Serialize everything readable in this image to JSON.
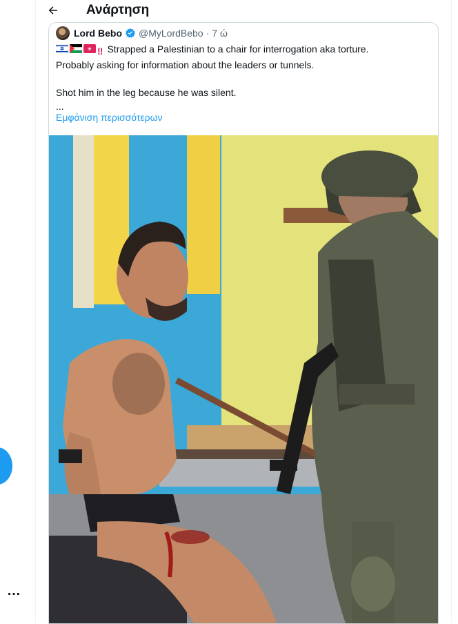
{
  "header": {
    "title": "Ανάρτηση"
  },
  "left_rail": {
    "more_label": "…"
  },
  "tweet": {
    "author_name": "Lord Bebo",
    "handle": "@MyLordBebo",
    "separator": "·",
    "time": "7 ώ",
    "text_line1": "Strapped a Palestinian to a chair for interrogation aka torture.",
    "text_line2": "Probably asking for information about the leaders or tunnels.",
    "text_line3": "Shot him in the leg because he was silent.",
    "text_line4": "...",
    "show_more": "Εμφάνιση περισσότερων",
    "emojis": [
      "israel-flag",
      "palestine-flag",
      "red-sign-emoji",
      "double-exclamation-emoji"
    ]
  },
  "colors": {
    "accent": "#1d9bf0",
    "text": "#0f1419",
    "secondary": "#536471",
    "border": "#cfd9de"
  }
}
